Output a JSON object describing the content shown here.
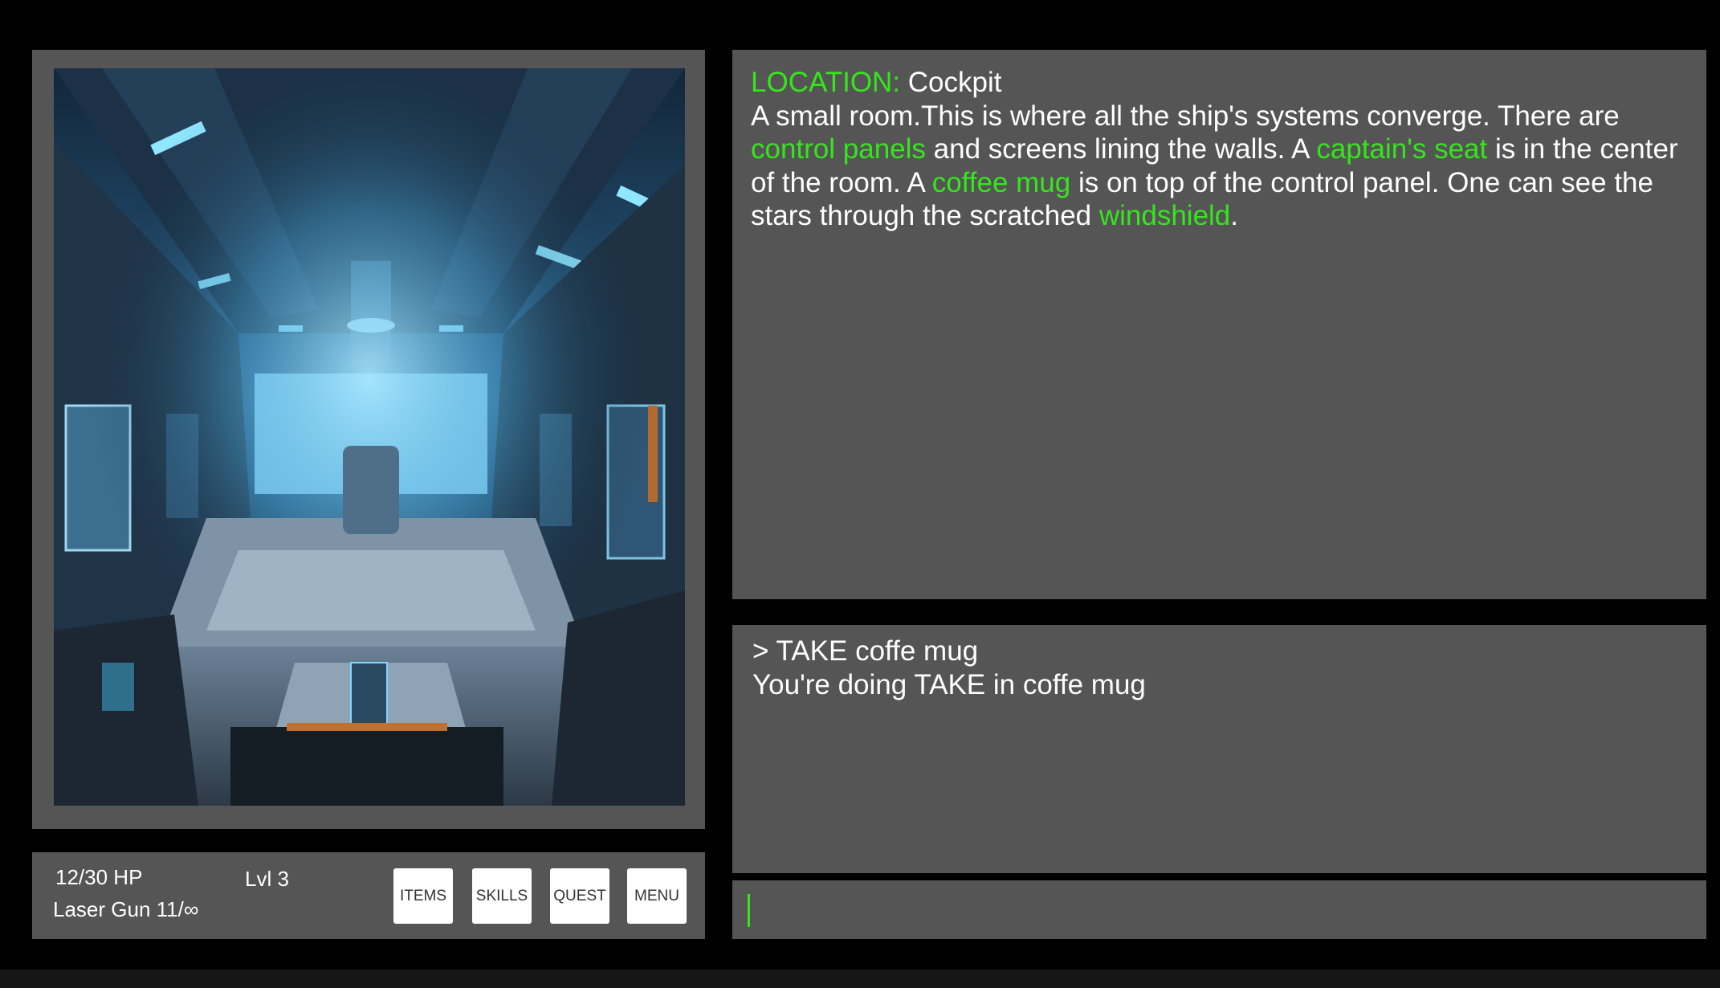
{
  "scene": {
    "image_icon": "spaceship-cockpit-illustration"
  },
  "status": {
    "hp": "12/30 HP",
    "level": "Lvl 3",
    "weapon": "Laser Gun 11/∞"
  },
  "buttons": {
    "items": "ITEMS",
    "skills": "SKILLS",
    "quest": "QUEST",
    "menu": "MENU"
  },
  "description": {
    "location_label": "LOCATION:",
    "location_name": " Cockpit",
    "text_1": "A small room.This is where all the ship's systems converge. There are ",
    "object_1": "control panels",
    "text_2": " and screens lining the walls. A ",
    "object_2": "captain's seat",
    "text_3": " is in the center of the room. A ",
    "object_3": "coffee mug",
    "text_4": " is on top of the control panel. One can see the stars through the scratched ",
    "object_4": "windshield",
    "text_5": "."
  },
  "log": {
    "command": "> TAKE coffe mug",
    "response": "You're doing TAKE in coffe mug"
  },
  "input": {
    "value": ""
  },
  "colors": {
    "highlight": "#35e61c",
    "panel": "#555555",
    "background": "#000000"
  }
}
